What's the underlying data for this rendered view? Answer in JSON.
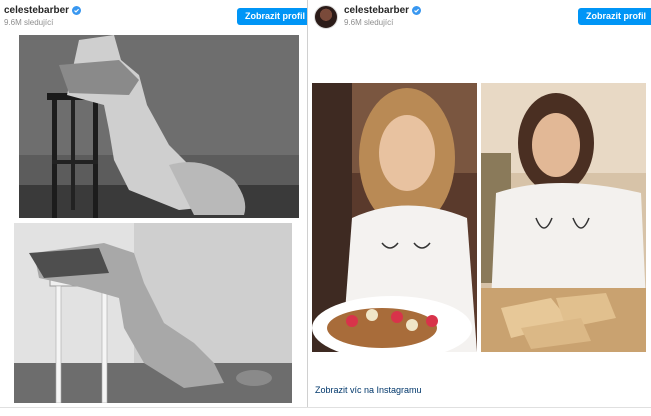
{
  "left_embed": {
    "username": "celestebarber",
    "followers": "9.6M sledující",
    "view_profile_label": "Zobrazit profil",
    "verified_icon": "verified-badge-icon",
    "photos": [
      "stool-pose-model-photo",
      "stool-pose-parody-photo"
    ]
  },
  "right_embed": {
    "username": "celestebarber",
    "followers": "9.6M sledující",
    "view_profile_label": "Zobrazit profil",
    "verified_icon": "verified-badge-icon",
    "photos": [
      "pancakes-model-photo",
      "toast-parody-photo"
    ],
    "more_link": "Zobrazit víc na Instagramu"
  },
  "colors": {
    "button": "#0095f6",
    "link": "#00376b",
    "muted_text": "#8e8e8e"
  }
}
